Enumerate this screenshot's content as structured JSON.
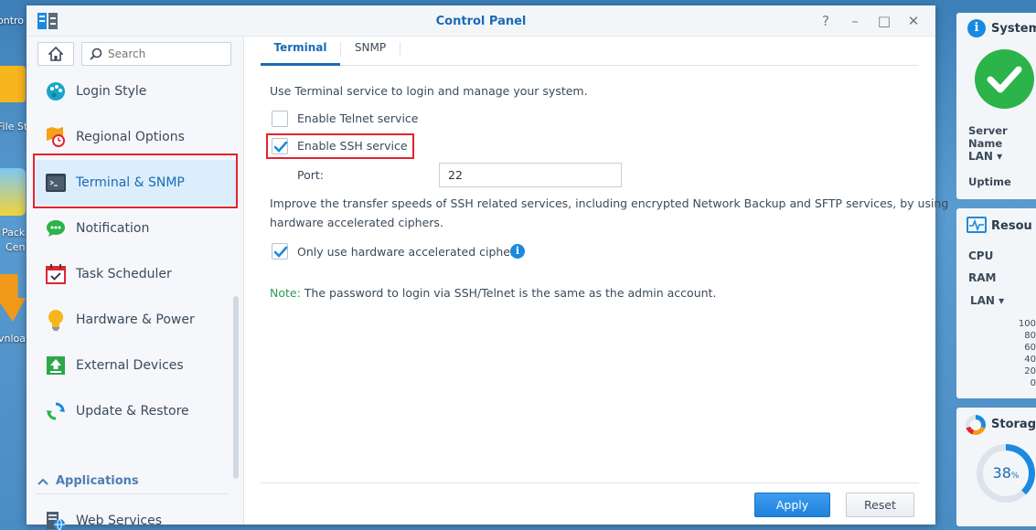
{
  "desktop": {
    "labels": [
      "ontro",
      "File St",
      "Pack",
      "Cen",
      "vnloa"
    ]
  },
  "window": {
    "title": "Control Panel",
    "controls": {
      "help": "?",
      "minimize": "–",
      "maximize": "□",
      "close": "✕"
    }
  },
  "sidebar": {
    "search_placeholder": "Search",
    "items": [
      {
        "label": "Login Style",
        "icon": "palette-icon"
      },
      {
        "label": "Regional Options",
        "icon": "clock-map-icon"
      },
      {
        "label": "Terminal & SNMP",
        "icon": "terminal-icon"
      },
      {
        "label": "Notification",
        "icon": "chat-bubble-icon"
      },
      {
        "label": "Task Scheduler",
        "icon": "calendar-check-icon"
      },
      {
        "label": "Hardware & Power",
        "icon": "lightbulb-icon"
      },
      {
        "label": "External Devices",
        "icon": "upload-box-icon"
      },
      {
        "label": "Update & Restore",
        "icon": "refresh-icon"
      }
    ],
    "section_title": "Applications",
    "section_items": [
      {
        "label": "Web Services",
        "icon": "web-server-icon"
      }
    ]
  },
  "tabs": [
    "Terminal",
    "SNMP"
  ],
  "content": {
    "intro": "Use Terminal service to login and manage your system.",
    "telnet_label": "Enable Telnet service",
    "telnet_checked": false,
    "ssh_label": "Enable SSH service",
    "ssh_checked": true,
    "port_label": "Port:",
    "port_value": "22",
    "improve_line1": "Improve the transfer speeds of SSH related services, including encrypted Network Backup and SFTP services, by using",
    "improve_line2": "hardware accelerated ciphers.",
    "cipher_label": "Only use hardware accelerated ciphers",
    "cipher_checked": true,
    "note_label": "Note:",
    "note_text": " The password to login via SSH/Telnet is the same as the admin account."
  },
  "buttons": {
    "apply": "Apply",
    "reset": "Reset"
  },
  "widgets": {
    "system": {
      "title": "System",
      "server_name": "Server Name",
      "lan": "LAN ▾",
      "uptime": "Uptime"
    },
    "resource": {
      "title": "Resou",
      "cpu": "CPU",
      "ram": "RAM",
      "lan": "LAN ▾",
      "scale": [
        "100",
        "80",
        "60",
        "40",
        "20",
        "0"
      ]
    },
    "storage": {
      "title": "Storag",
      "percent": "38",
      "percent_unit": "%",
      "percent_value": 38
    }
  },
  "colors": {
    "accent": "#1a6ab8",
    "highlight": "#e0252e",
    "success": "#2cb34a",
    "note": "#2f9a58"
  }
}
